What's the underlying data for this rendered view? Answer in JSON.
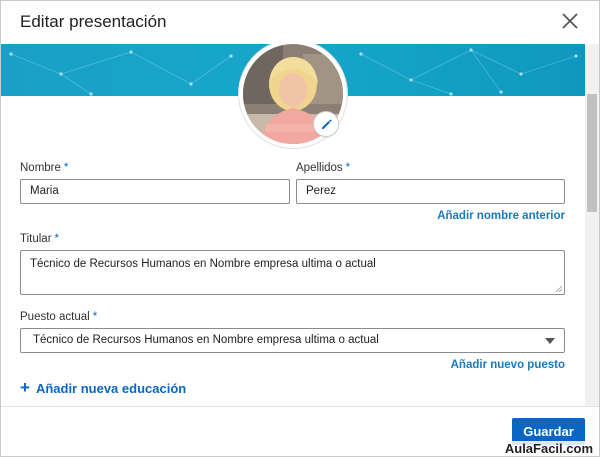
{
  "dialog": {
    "title": "Editar presentación"
  },
  "form": {
    "first_name": {
      "label": "Nombre",
      "required": "*",
      "value": "Maria"
    },
    "last_name": {
      "label": "Apellidos",
      "required": "*",
      "value": "Perez"
    },
    "add_former_name_link": "Añadir nombre anterior",
    "headline": {
      "label": "Titular",
      "required": "*",
      "value": "Técnico de Recursos Humanos en Nombre empresa ultima o actual"
    },
    "current_position": {
      "label": "Puesto actual",
      "required": "*",
      "selected": "Técnico de Recursos Humanos en Nombre empresa ultima o actual"
    },
    "add_position_link": "Añadir nuevo puesto",
    "add_education": {
      "plus": "+",
      "label": "Añadir nueva educación"
    }
  },
  "footer": {
    "save_label": "Guardar"
  },
  "watermark": "AulaFacil.com",
  "colors": {
    "accent": "#0a66c2",
    "link": "#1a7ab8",
    "banner": "#16a7c9"
  },
  "icons": {
    "close": "close-icon",
    "edit_photo": "pencil-icon"
  }
}
